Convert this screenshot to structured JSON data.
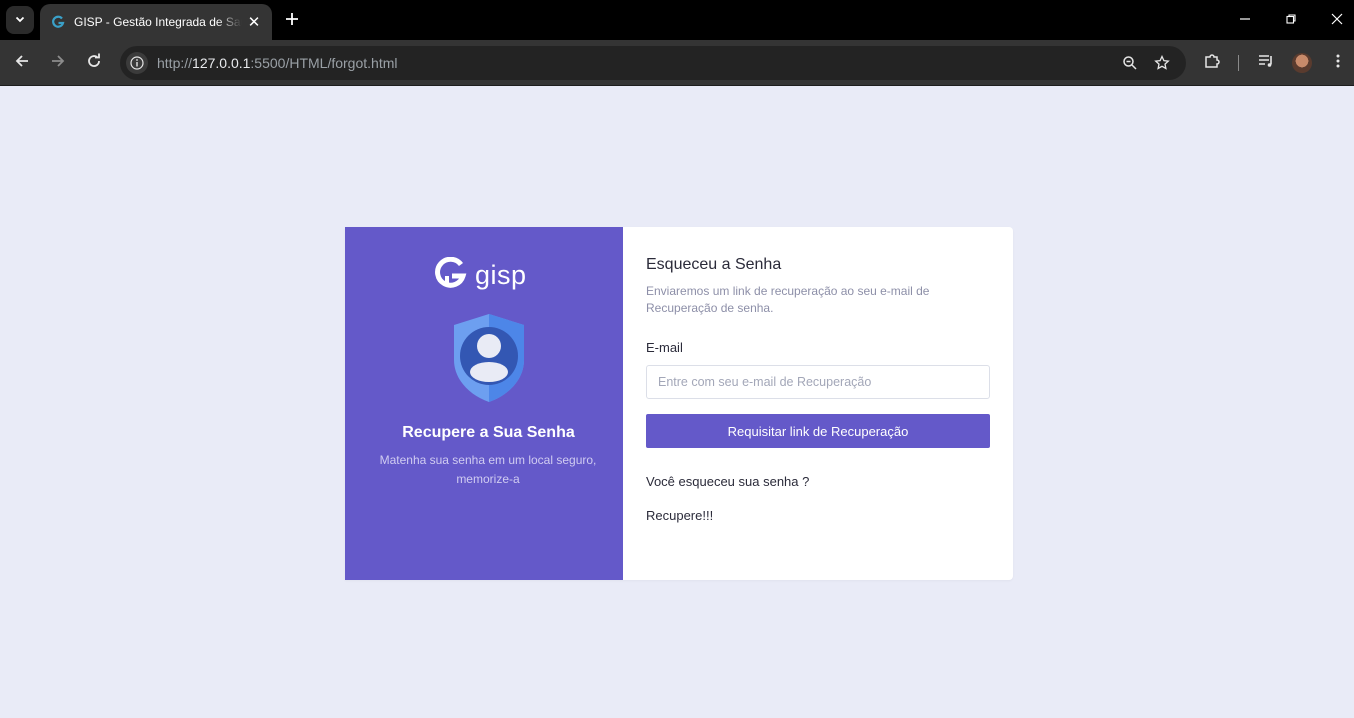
{
  "browser": {
    "tab_title": "GISP - Gestão Integrada de Saúde",
    "url_prefix": "http://",
    "url_host": "127.0.0.1",
    "url_rest": ":5500/HTML/forgot.html"
  },
  "left_panel": {
    "logo_text": "gisp",
    "title": "Recupere a Sua Senha",
    "subtitle": "Matenha sua senha em um local seguro, memorize-a",
    "accent_color": "#6459c9"
  },
  "form": {
    "title": "Esqueceu a Senha",
    "description": "Enviaremos um link de recuperação ao seu e-mail de Recuperação de senha.",
    "email_label": "E-mail",
    "email_placeholder": "Entre com seu e-mail de Recuperação",
    "email_value": "",
    "submit_label": "Requisitar link de Recuperação",
    "forgot_question": "Você esqueceu sua senha ?",
    "recover_link": "Recupere!!!"
  }
}
